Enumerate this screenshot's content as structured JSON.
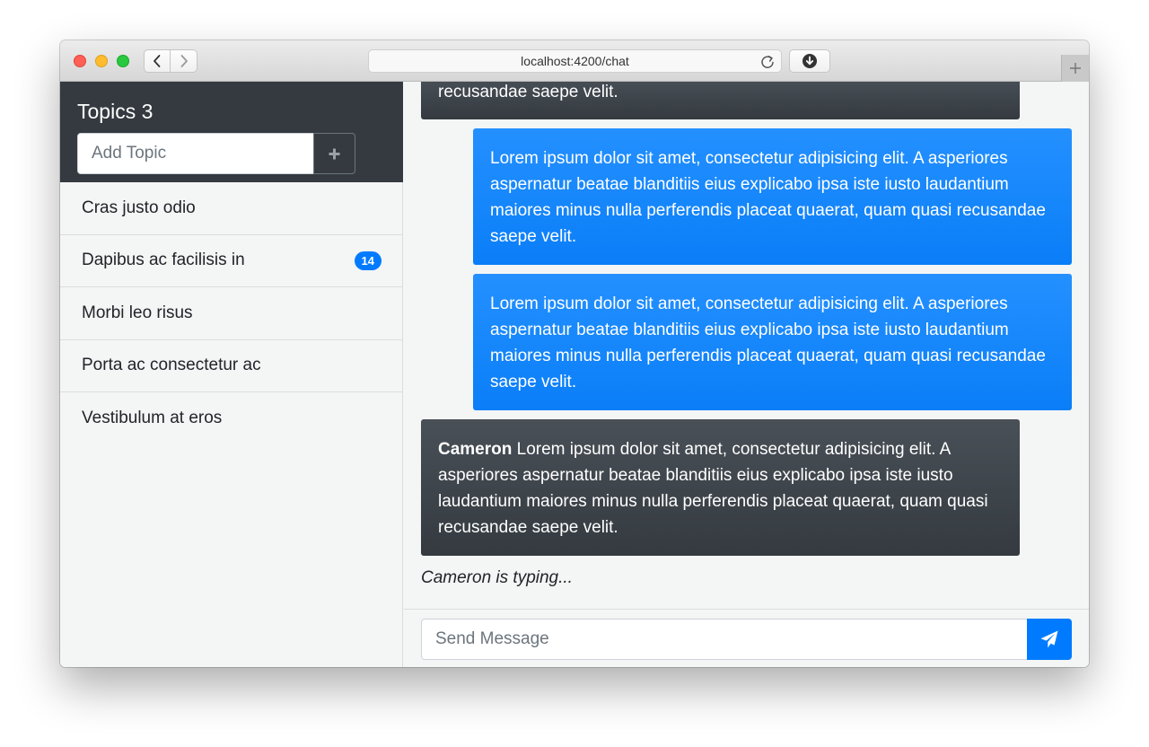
{
  "browser": {
    "url": "localhost:4200/chat"
  },
  "sidebar": {
    "title": "Topics 3",
    "add_topic_placeholder": "Add Topic",
    "topics": [
      {
        "label": "Cras justo odio",
        "badge": null
      },
      {
        "label": "Dapibus ac facilisis in",
        "badge": "14"
      },
      {
        "label": "Morbi leo risus",
        "badge": null
      },
      {
        "label": "Porta ac consectetur ac",
        "badge": null
      },
      {
        "label": "Vestibulum at eros",
        "badge": null
      }
    ]
  },
  "chat": {
    "messages": [
      {
        "type": "received",
        "author": "",
        "text": "recusandae saepe velit."
      },
      {
        "type": "sent",
        "text": "Lorem ipsum dolor sit amet, consectetur adipisicing elit. A asperiores aspernatur beatae blanditiis eius explicabo ipsa iste iusto laudantium maiores minus nulla perferendis placeat quaerat, quam quasi recusandae saepe velit."
      },
      {
        "type": "sent",
        "text": "Lorem ipsum dolor sit amet, consectetur adipisicing elit. A asperiores aspernatur beatae blanditiis eius explicabo ipsa iste iusto laudantium maiores minus nulla perferendis placeat quaerat, quam quasi recusandae saepe velit."
      },
      {
        "type": "received",
        "author": "Cameron",
        "text": "Lorem ipsum dolor sit amet, consectetur adipisicing elit. A asperiores aspernatur beatae blanditiis eius explicabo ipsa iste iusto laudantium maiores minus nulla perferendis placeat quaerat, quam quasi recusandae saepe velit."
      }
    ],
    "typing_indicator": "Cameron is typing...",
    "send_placeholder": "Send Message"
  },
  "icons": {
    "back": "chevron-left-icon",
    "forward": "chevron-right-icon",
    "reload": "reload-icon",
    "download": "download-icon",
    "new_tab": "plus-icon",
    "add_topic": "plus-icon",
    "send": "paper-plane-icon"
  },
  "colors": {
    "primary": "#007bff",
    "dark": "#343a40",
    "background": "#f4f5f5"
  }
}
